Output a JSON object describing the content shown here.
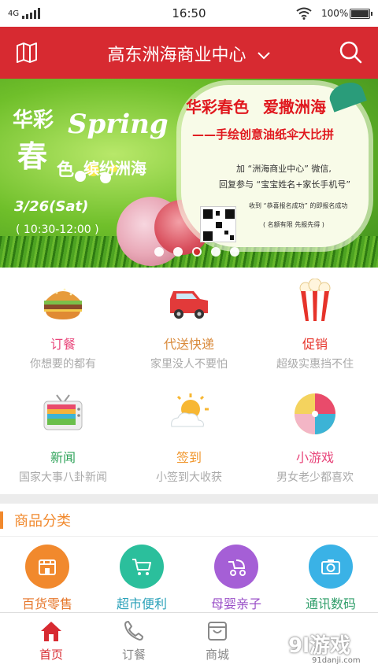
{
  "status_bar": {
    "network": "4G",
    "time": "16:50",
    "battery": "100%"
  },
  "header": {
    "title": "高东洲海商业中心"
  },
  "banner": {
    "line_huacai": "华彩",
    "line_spring": "Spring",
    "line_chun": "春",
    "line_se": "色",
    "line_binfen": "缤纷洲海",
    "date": "3/26(Sat)",
    "time": "( 10:30-12:00 )",
    "headline_1": "华彩春色",
    "headline_2": "爱撒洲海",
    "subtitle": "——手绘创意油纸伞大比拼",
    "info_1": "加 “洲海商业中心” 微信,",
    "info_2": "回复参与 “宝宝姓名+家长手机号”",
    "info_3": "收到 “恭喜报名成功” 的即报名成功",
    "info_4": "( 名额有限 先报先得 )",
    "slides": 5,
    "active_slide": 3
  },
  "features": [
    {
      "label": "订餐",
      "desc": "你想要的都有",
      "color": "#e8457a",
      "icon": "burger-icon"
    },
    {
      "label": "代送快递",
      "desc": "家里没人不要怕",
      "color": "#d98a3b",
      "icon": "car-icon"
    },
    {
      "label": "促销",
      "desc": "超级实惠挡不住",
      "color": "#e6332a",
      "icon": "popcorn-icon"
    },
    {
      "label": "新闻",
      "desc": "国家大事八卦新闻",
      "color": "#2fa35a",
      "icon": "tv-icon"
    },
    {
      "label": "签到",
      "desc": "小签到大收获",
      "color": "#f0952a",
      "icon": "weather-sun-icon"
    },
    {
      "label": "小游戏",
      "desc": "男女老少都喜欢",
      "color": "#e8457a",
      "icon": "beach-ball-icon"
    }
  ],
  "category_section": {
    "title": "商品分类",
    "items": [
      {
        "label": "百货零售",
        "color": "#f1892d",
        "text_color": "#e6762a",
        "icon": "store-icon"
      },
      {
        "label": "超市便利",
        "color": "#2bbf9c",
        "text_color": "#2aa1b9",
        "icon": "cart-icon"
      },
      {
        "label": "母婴亲子",
        "color": "#a55fd6",
        "text_color": "#9a50c8",
        "icon": "stroller-icon"
      },
      {
        "label": "通讯数码",
        "color": "#3ab2e6",
        "text_color": "#2f9e6a",
        "icon": "camera-icon"
      }
    ]
  },
  "tabbar": {
    "items": [
      {
        "label": "首页",
        "icon": "home-icon"
      },
      {
        "label": "订餐",
        "icon": "phone-icon"
      },
      {
        "label": "商城",
        "icon": "shopping-bag-icon"
      }
    ]
  },
  "watermark": {
    "logo": "9l游戏",
    "url": "91danji.com"
  },
  "colors": {
    "brand_red": "#d72a31",
    "accent_orange": "#f1892d"
  }
}
